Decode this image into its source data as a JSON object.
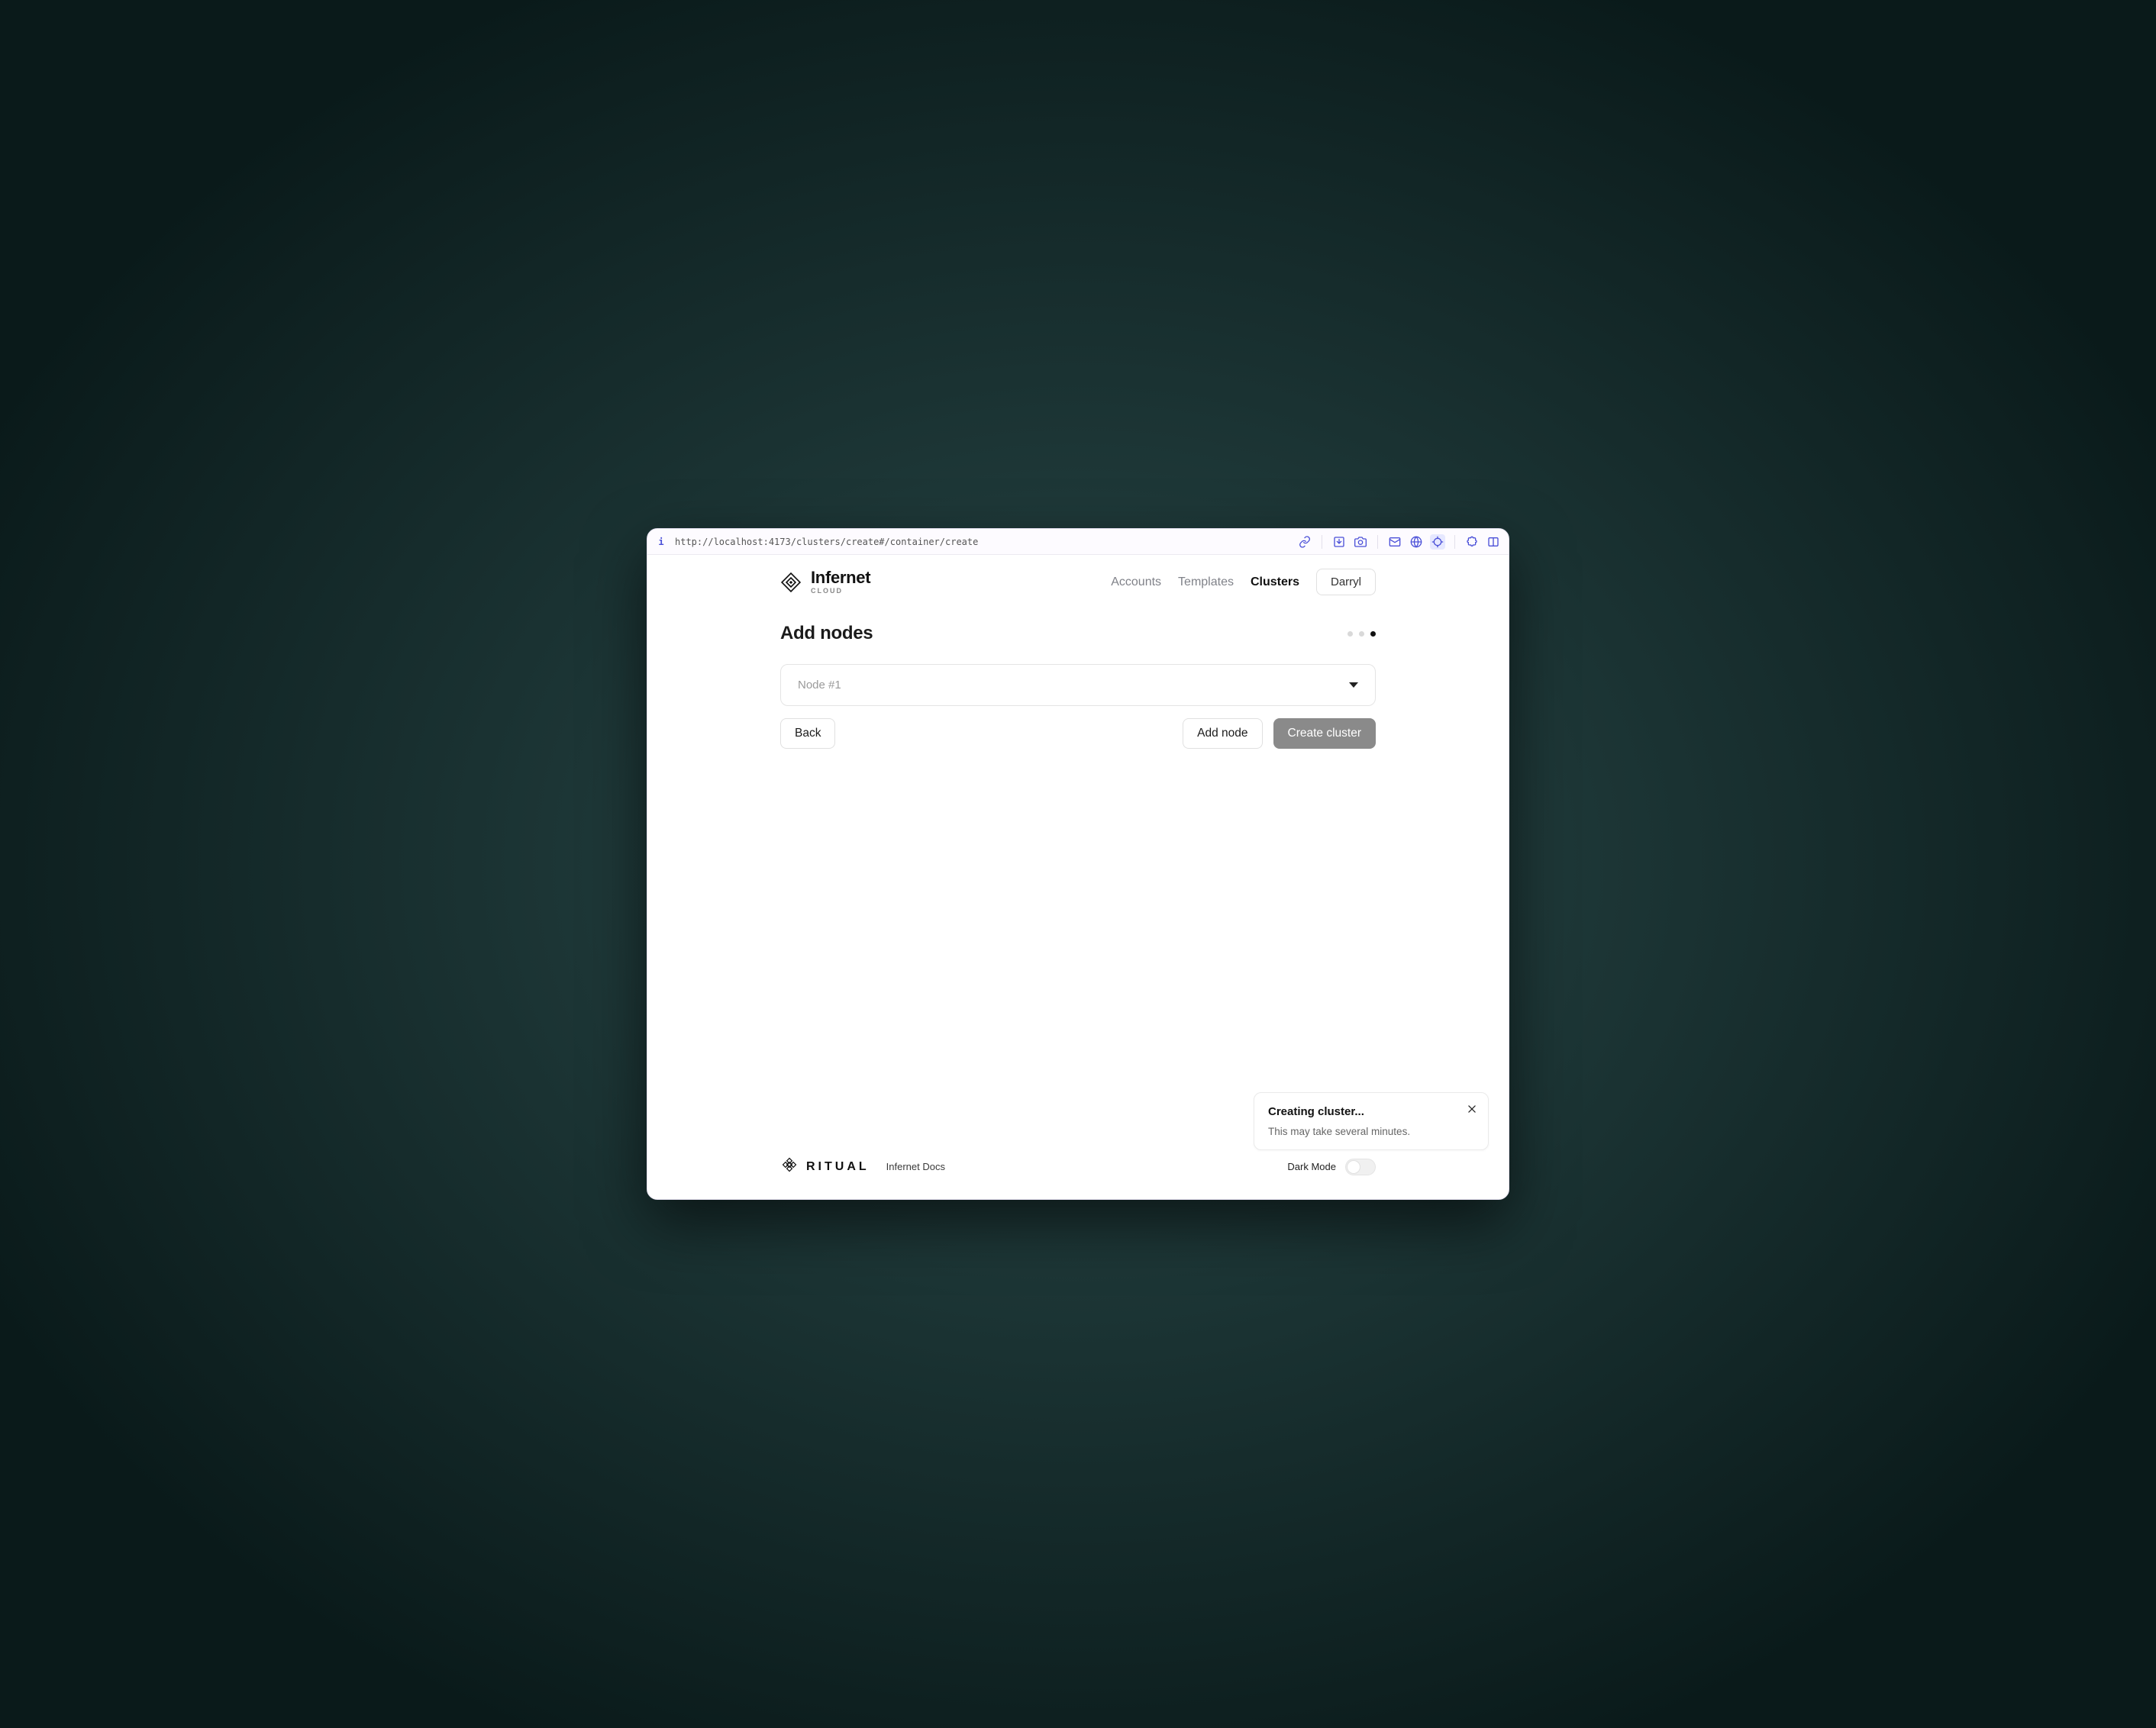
{
  "browser": {
    "url": "http://localhost:4173/clusters/create#/container/create"
  },
  "header": {
    "brand_name": "Infernet",
    "brand_sub": "CLOUD",
    "nav": {
      "accounts": "Accounts",
      "templates": "Templates",
      "clusters": "Clusters"
    },
    "user_name": "Darryl"
  },
  "page": {
    "title": "Add nodes",
    "step_progress": {
      "total": 3,
      "current": 3
    }
  },
  "node_panel": {
    "label": "Node #1"
  },
  "actions": {
    "back": "Back",
    "add_node": "Add node",
    "create": "Create cluster"
  },
  "footer": {
    "ritual": "RITUAL",
    "docs": "Infernet Docs",
    "dark_mode": "Dark Mode"
  },
  "toast": {
    "title": "Creating cluster...",
    "body": "This may take several minutes."
  }
}
